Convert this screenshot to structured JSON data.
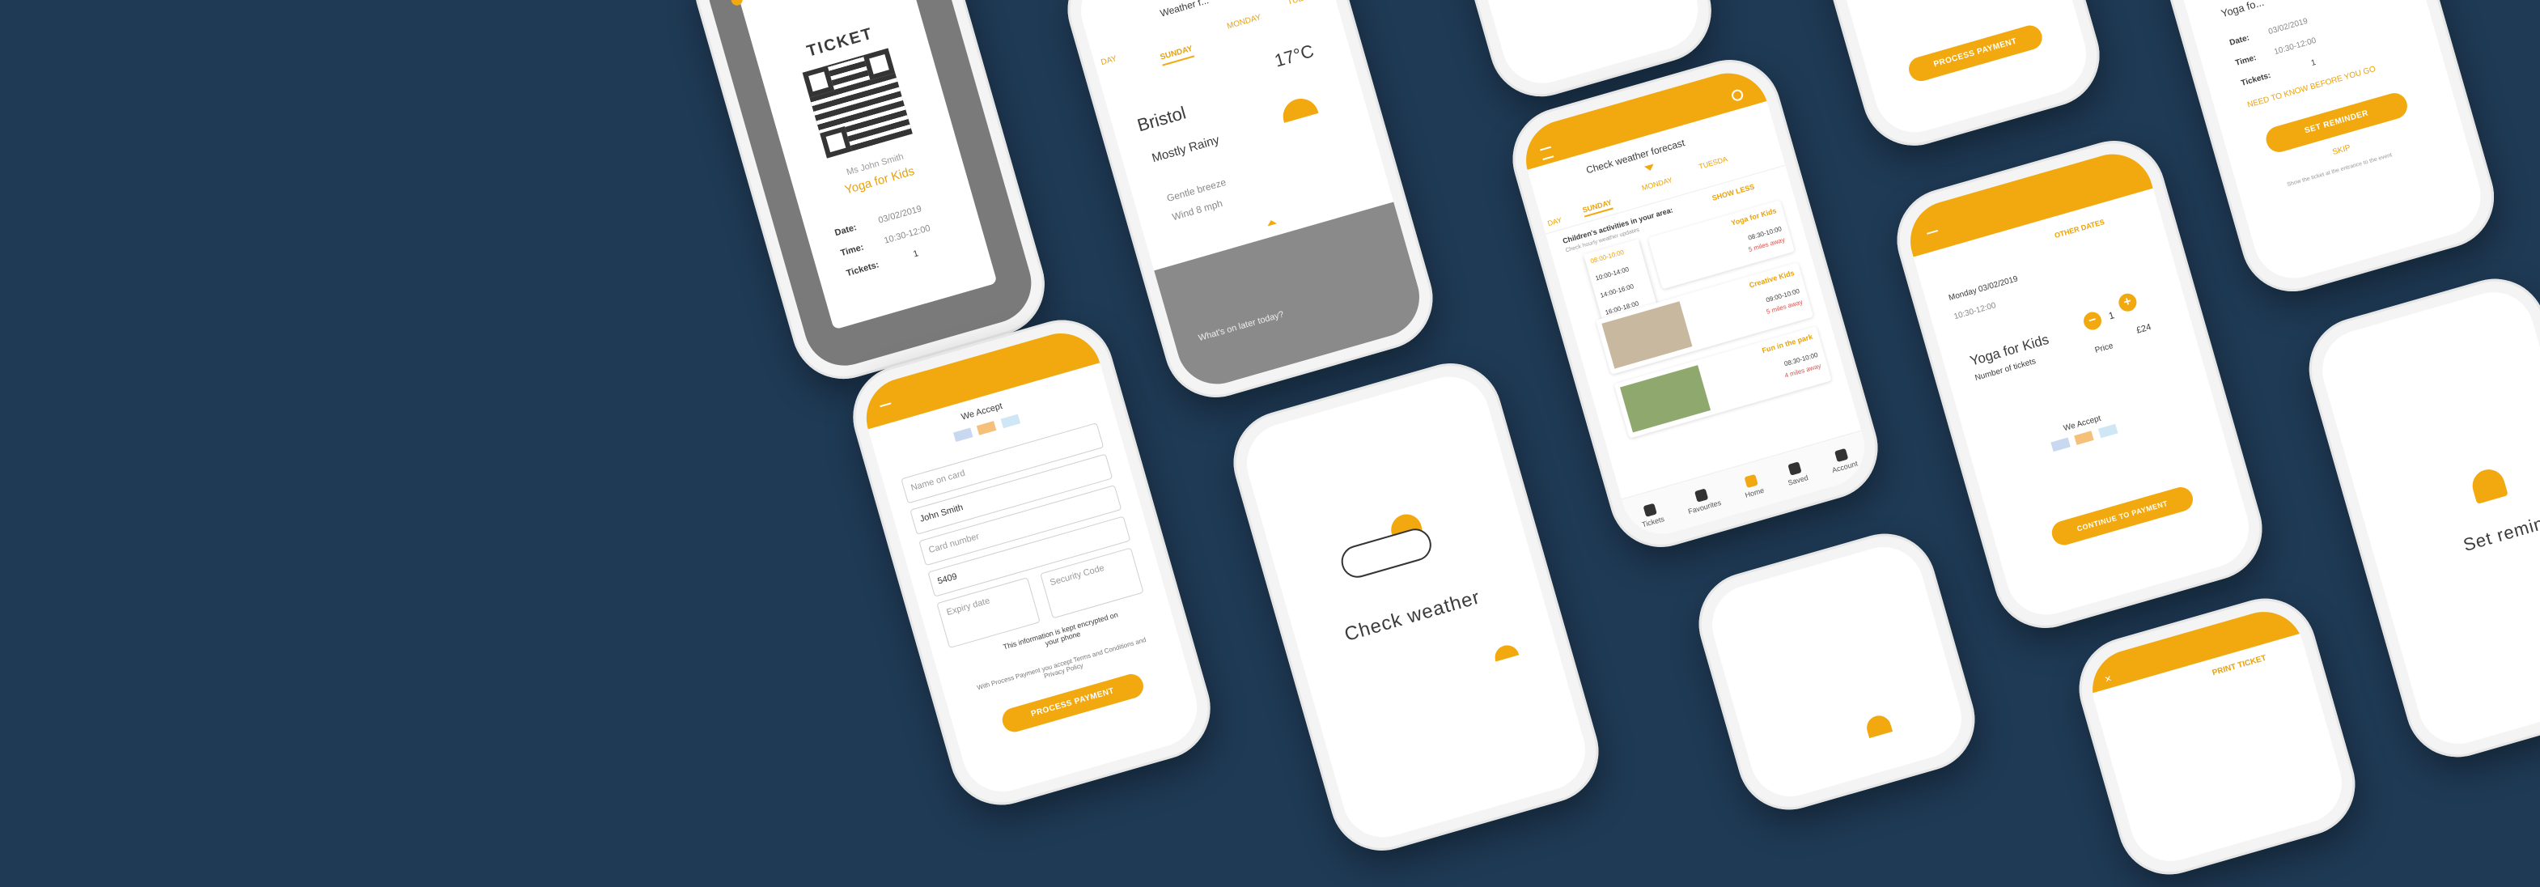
{
  "ticket_screen": {
    "title": "TICKET",
    "holder": "Ms John Smith",
    "event": "Yoga for Kids",
    "date_label": "Date:",
    "date_value": "03/02/2019",
    "time_label": "Time:",
    "time_value": "10:30-12:00",
    "tickets_label": "Tickets:",
    "tickets_value": "1"
  },
  "weather_screen": {
    "header": "Weather f...",
    "tabs": [
      "DAY",
      "SUNDAY",
      "MONDAY",
      "TUESDA"
    ],
    "city": "Bristol",
    "temp": "17°C",
    "condition": "Mostly Rainy",
    "breeze": "Gentle breeze",
    "wind": "Wind 8 mph",
    "overlay_text": "What's on later today?"
  },
  "forecast_screen": {
    "header": "Check weather forecast",
    "tabs": [
      "DAY",
      "SUNDAY",
      "MONDAY",
      "TUESDA"
    ],
    "section_title": "Children's activities in your area:",
    "section_sub": "Check hourly weather updates",
    "show_less": "SHOW LESS",
    "times": [
      "08:00-10:00",
      "10:00-14:00",
      "14:00-16:00",
      "16:00-18:00"
    ],
    "activities": [
      {
        "name": "Yoga for Kids",
        "time": "08:30-10:00",
        "dist": "5 miles away"
      },
      {
        "name": "Creative Kids",
        "time": "09:00-10:00",
        "dist": "5 miles away"
      },
      {
        "name": "Fun in the park",
        "time": "08:30-10:00",
        "dist": "4 miles away"
      }
    ],
    "tabbar": [
      "Tickets",
      "Favourites",
      "Home",
      "Saved",
      "Account"
    ]
  },
  "payment_screen": {
    "we_accept": "We Accept",
    "name_on_card": "Name on card",
    "name_value": "John Smith",
    "card_number": "Card number",
    "card_value": "5409",
    "expiry": "Expiry date",
    "security": "Security Code",
    "encrypted": "This information is kept encrypted on your phone",
    "terms_pre": "With Process Payment you accept Terms and Conditions and Privacy Policy",
    "process": "PROCESS PAYMENT"
  },
  "check_weather_screen": {
    "title": "Check weather"
  },
  "process_top": {
    "process": "PROCESS PAYMENT"
  },
  "booking_screen": {
    "other_dates": "OTHER DATES",
    "date": "Monday 03/02/2019",
    "time": "10:30-12:00",
    "event": "Yoga for Kids",
    "tickets_label": "Number of tickets",
    "count": "1",
    "price_label": "Price",
    "price": "£24",
    "we_accept": "We Accept",
    "continue": "CONTINUE TO PAYMENT"
  },
  "reminder_top": {
    "event": "Yoga fo...",
    "date_label": "Date:",
    "date_value": "03/02/2019",
    "time_label": "Time:",
    "time_value": "10:30-12:00",
    "tickets_label": "Tickets:",
    "tickets_value": "1",
    "need_to_know": "NEED TO KNOW BEFORE YOU GO",
    "set_reminder": "SET REMINDER",
    "skip": "SKIP",
    "note": "Show the ticket at the entrance to the event"
  },
  "set_reminder_screen": {
    "title": "Set reminde"
  },
  "print_screen": {
    "print": "PRINT TICKET"
  },
  "colors": {
    "background": "#1f3a55",
    "accent": "#f2a90f"
  }
}
